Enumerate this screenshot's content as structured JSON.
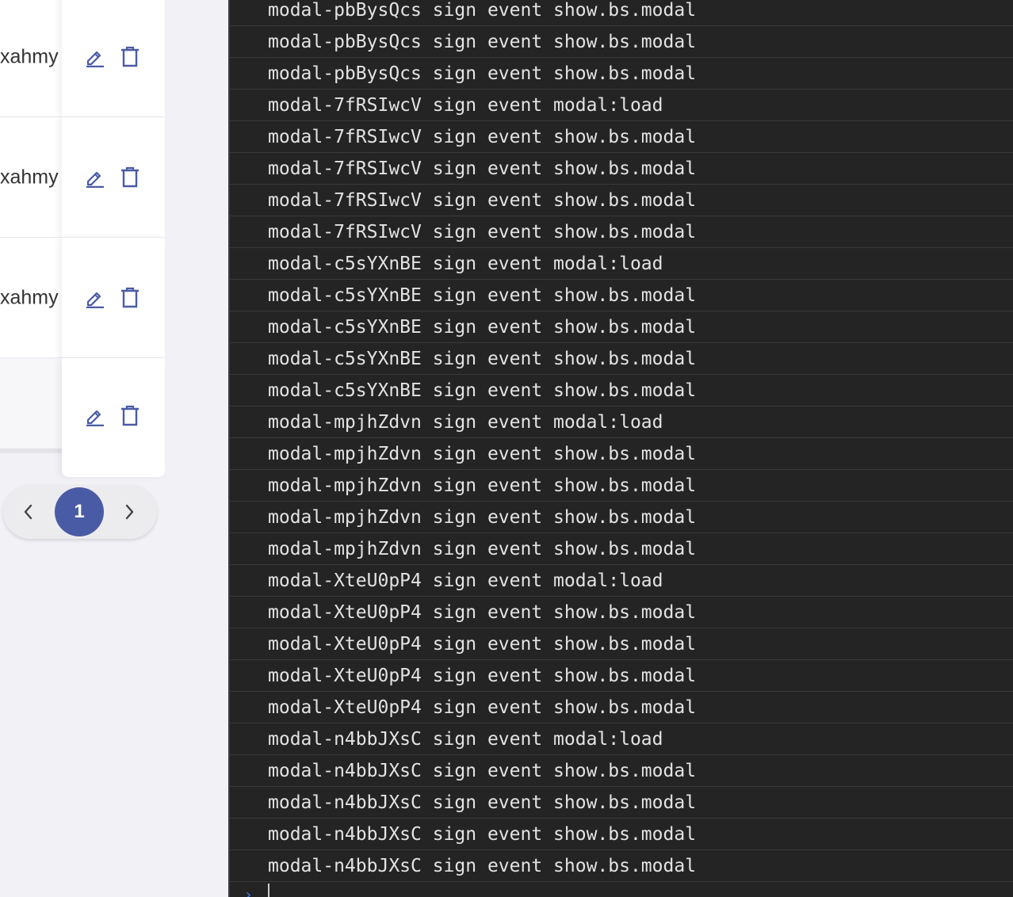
{
  "table": {
    "rows": [
      {
        "name": "xahmy"
      },
      {
        "name": "xahmy"
      },
      {
        "name": "xahmy"
      },
      {
        "name": ""
      }
    ]
  },
  "pagination": {
    "current_page": "1"
  },
  "icons": {
    "edit": "pencil-icon",
    "delete": "trash-icon",
    "prev": "chevron-left-icon",
    "next": "chevron-right-icon"
  },
  "colors": {
    "accent": "#4a5ba6",
    "console_bg": "#242424",
    "console_text": "#e3e3e3",
    "prompt_caret": "#3b82f6"
  },
  "console": {
    "lines": [
      "modal-pbBysQcs sign event show.bs.modal",
      "modal-pbBysQcs sign event show.bs.modal",
      "modal-pbBysQcs sign event show.bs.modal",
      "modal-7fRSIwcV sign event modal:load",
      "modal-7fRSIwcV sign event show.bs.modal",
      "modal-7fRSIwcV sign event show.bs.modal",
      "modal-7fRSIwcV sign event show.bs.modal",
      "modal-7fRSIwcV sign event show.bs.modal",
      "modal-c5sYXnBE sign event modal:load",
      "modal-c5sYXnBE sign event show.bs.modal",
      "modal-c5sYXnBE sign event show.bs.modal",
      "modal-c5sYXnBE sign event show.bs.modal",
      "modal-c5sYXnBE sign event show.bs.modal",
      "modal-mpjhZdvn sign event modal:load",
      "modal-mpjhZdvn sign event show.bs.modal",
      "modal-mpjhZdvn sign event show.bs.modal",
      "modal-mpjhZdvn sign event show.bs.modal",
      "modal-mpjhZdvn sign event show.bs.modal",
      "modal-XteU0pP4 sign event modal:load",
      "modal-XteU0pP4 sign event show.bs.modal",
      "modal-XteU0pP4 sign event show.bs.modal",
      "modal-XteU0pP4 sign event show.bs.modal",
      "modal-XteU0pP4 sign event show.bs.modal",
      "modal-n4bbJXsC sign event modal:load",
      "modal-n4bbJXsC sign event show.bs.modal",
      "modal-n4bbJXsC sign event show.bs.modal",
      "modal-n4bbJXsC sign event show.bs.modal",
      "modal-n4bbJXsC sign event show.bs.modal"
    ],
    "prompt_value": ""
  }
}
